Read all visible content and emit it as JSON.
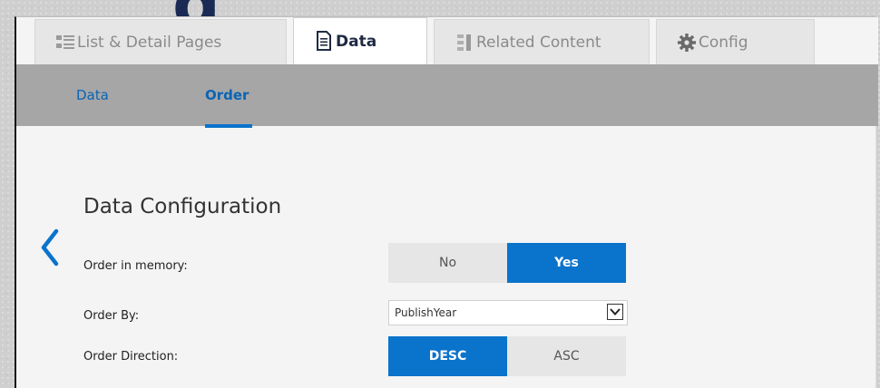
{
  "tabs": [
    {
      "label": "List & Detail Pages",
      "icon": "list-icon",
      "active": false
    },
    {
      "label": "Data",
      "icon": "document-icon",
      "active": true
    },
    {
      "label": "Related Content",
      "icon": "related-icon",
      "active": false
    },
    {
      "label": "Config",
      "icon": "gear-icon",
      "active": false
    }
  ],
  "subnav": {
    "items": [
      {
        "label": "Data",
        "active": false
      },
      {
        "label": "Order",
        "active": true
      }
    ]
  },
  "section": {
    "title": "Data Configuration"
  },
  "form": {
    "order_in_memory": {
      "label": "Order in memory:",
      "options": [
        "No",
        "Yes"
      ],
      "selected": "Yes"
    },
    "order_by": {
      "label": "Order By:",
      "value": "PublishYear"
    },
    "order_direction": {
      "label": "Order Direction:",
      "options": [
        "DESC",
        "ASC"
      ],
      "selected": "DESC"
    }
  },
  "colors": {
    "accent": "#0a73cc",
    "subnav_bg": "#a6a6a6",
    "panel_bg": "#f4f4f4"
  }
}
